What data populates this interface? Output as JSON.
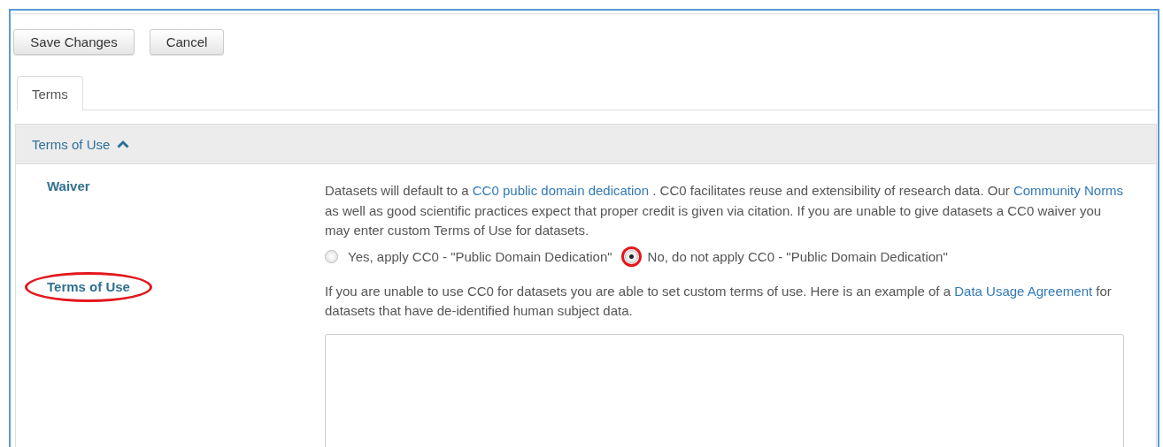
{
  "toolbar": {
    "buttons": [
      {
        "label": "Save Changes",
        "kind": "save"
      },
      {
        "label": "Cancel",
        "kind": "cancel"
      }
    ]
  },
  "tabs": [
    {
      "label": "Terms",
      "selected": true
    }
  ],
  "panel": {
    "title": "Terms of Use",
    "expanded": true,
    "fields": [
      {
        "label": "Waiver",
        "circled": false,
        "kind": "waiver",
        "description": [
          {
            "text": "Datasets will default to a "
          },
          {
            "text": "CC0 public domain dedication",
            "link": true
          },
          {
            "text": " . CC0 facilitates reuse and extensibility of research data. Our "
          },
          {
            "text": "Community Norms",
            "link": true
          },
          {
            "text": " as well as good scientific practices expect that proper credit is given via citation. If you are unable to give datasets a CC0 waiver you may enter custom Terms of Use for datasets."
          }
        ],
        "options": [
          {
            "label": "Yes, apply CC0 - \"Public Domain Dedication\"",
            "selected": false,
            "circled": false
          },
          {
            "label": "No, do not apply CC0 - \"Public Domain Dedication\"",
            "selected": true,
            "circled": true
          }
        ]
      },
      {
        "label": "Terms of Use",
        "circled": true,
        "kind": "terms",
        "description": [
          {
            "text": "If you are unable to use CC0 for datasets you are able to set custom terms of use. Here is an example of a "
          },
          {
            "text": "Data Usage Agreement",
            "link": true
          },
          {
            "text": " for datasets that have de-identified human subject data."
          }
        ]
      }
    ]
  }
}
